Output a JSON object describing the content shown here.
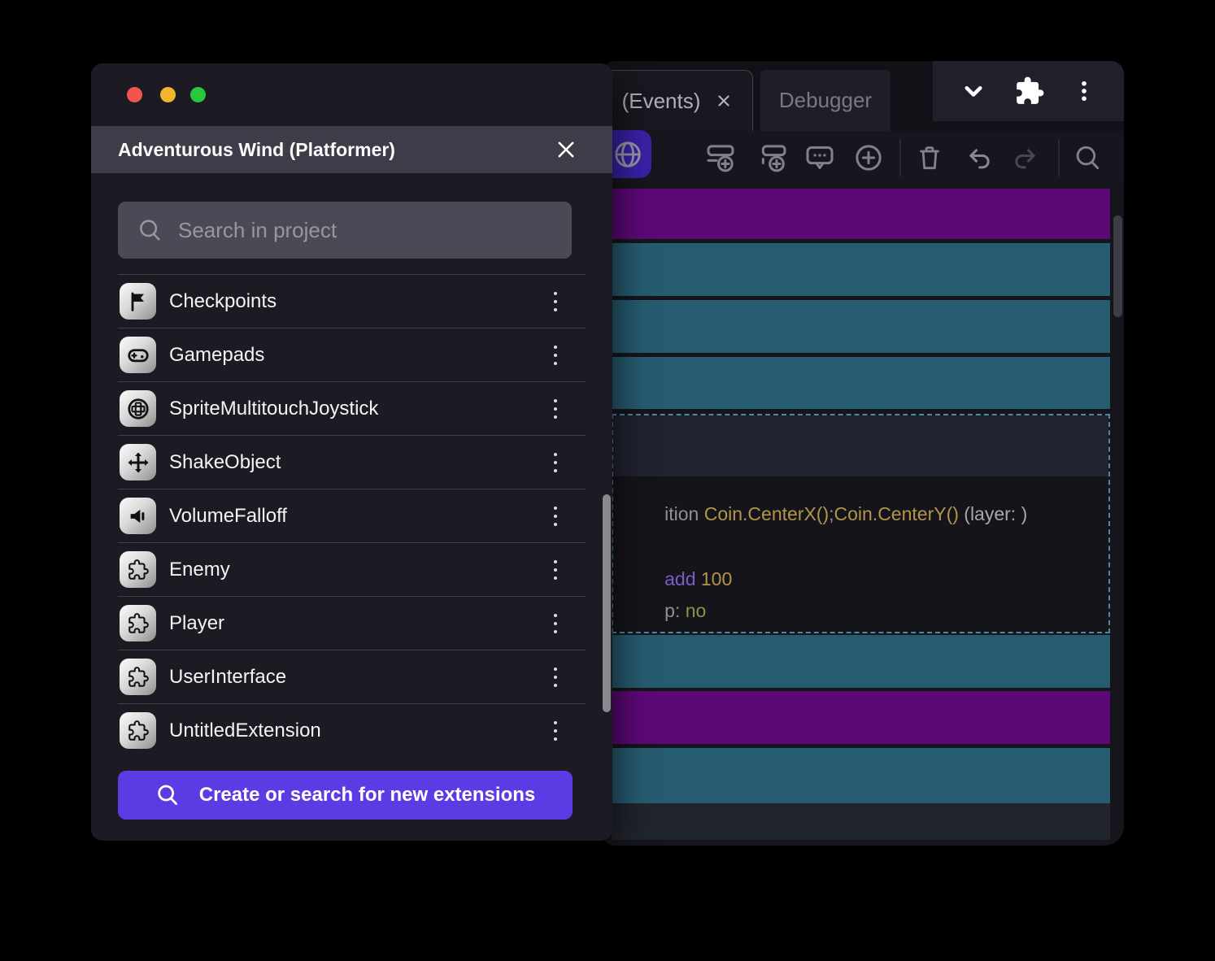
{
  "dialog": {
    "title": "Adventurous Wind (Platformer)",
    "search": {
      "placeholder": "Search in project"
    },
    "extensions": [
      {
        "label": "Checkpoints",
        "icon": "flag-icon"
      },
      {
        "label": "Gamepads",
        "icon": "gamepad-icon"
      },
      {
        "label": "SpriteMultitouchJoystick",
        "icon": "joystick-icon"
      },
      {
        "label": "ShakeObject",
        "icon": "move-arrows-icon"
      },
      {
        "label": "VolumeFalloff",
        "icon": "speaker-icon"
      },
      {
        "label": "Enemy",
        "icon": "puzzle-icon"
      },
      {
        "label": "Player",
        "icon": "puzzle-icon"
      },
      {
        "label": "UserInterface",
        "icon": "puzzle-icon"
      },
      {
        "label": "UntitledExtension",
        "icon": "puzzle-icon"
      }
    ],
    "create_button": {
      "label": "Create or search for new extensions"
    }
  },
  "editor": {
    "tabs": [
      {
        "label": "(Events)",
        "active": true,
        "closable": true
      },
      {
        "label": "Debugger",
        "active": false,
        "closable": false
      }
    ],
    "toolbar_icons": [
      "globe-icon",
      "add-event-icon",
      "add-subevent-icon",
      "add-comment-icon",
      "add-circle-icon",
      "trash-icon",
      "undo-icon",
      "redo-icon",
      "search-icon"
    ],
    "top_icons": [
      "chevron-down-icon",
      "puzzle-icon",
      "kebab-menu-icon"
    ],
    "selected_event": {
      "line1": {
        "prefix": "ition",
        "expr1": "Coin.CenterX()",
        "separator": ";",
        "expr2": "Coin.CenterY()",
        "suffix": "(layer: )"
      },
      "line2": {
        "keyword": "add",
        "value": "100"
      },
      "line3": {
        "label": "p:",
        "value": "no"
      }
    }
  },
  "colors": {
    "accent_purple": "#5C3BE5",
    "toolbar_purple": "#3A21A6",
    "event_purple": "#5D0877",
    "event_teal": "#265C70",
    "selection_dashed": "#4E89A4",
    "code_gold": "#B3954A",
    "code_purple": "#7B5CC4",
    "code_green": "#7F9C43",
    "traffic_red": "#F4544E",
    "traffic_yellow": "#F2B52E",
    "traffic_green": "#28C83C"
  }
}
